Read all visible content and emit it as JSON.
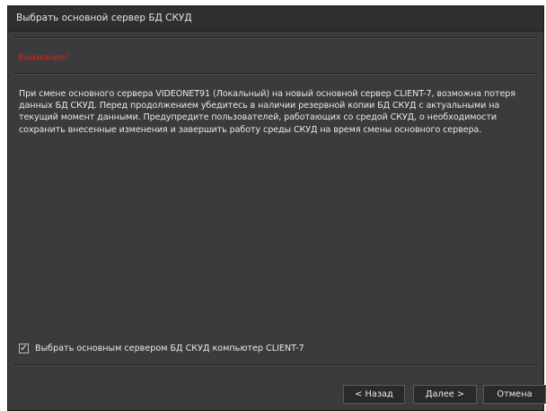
{
  "window": {
    "title": "Выбрать основной сервер БД СКУД"
  },
  "warning": {
    "label": "Внимание!",
    "color": "#e02020"
  },
  "message": {
    "text": "При смене основного сервера VIDEONET91 (Локальный) на новый основной сервер CLIENT-7, возможна потеря данных БД СКУД. Перед продолжением убедитесь в наличии резервной копии БД СКУД с актуальными на текущий момент данными. Предупредите пользователей, работающих со средой СКУД, о необходимости сохранить внесенные изменения и завершить работу среды СКУД на время смены основного сервера."
  },
  "option": {
    "label": "Выбрать основным сервером БД СКУД компьютер CLIENT-7",
    "checked": true,
    "check_glyph": "✓"
  },
  "buttons": {
    "back": "< Назад",
    "next": "Далее >",
    "cancel": "Отмена"
  }
}
